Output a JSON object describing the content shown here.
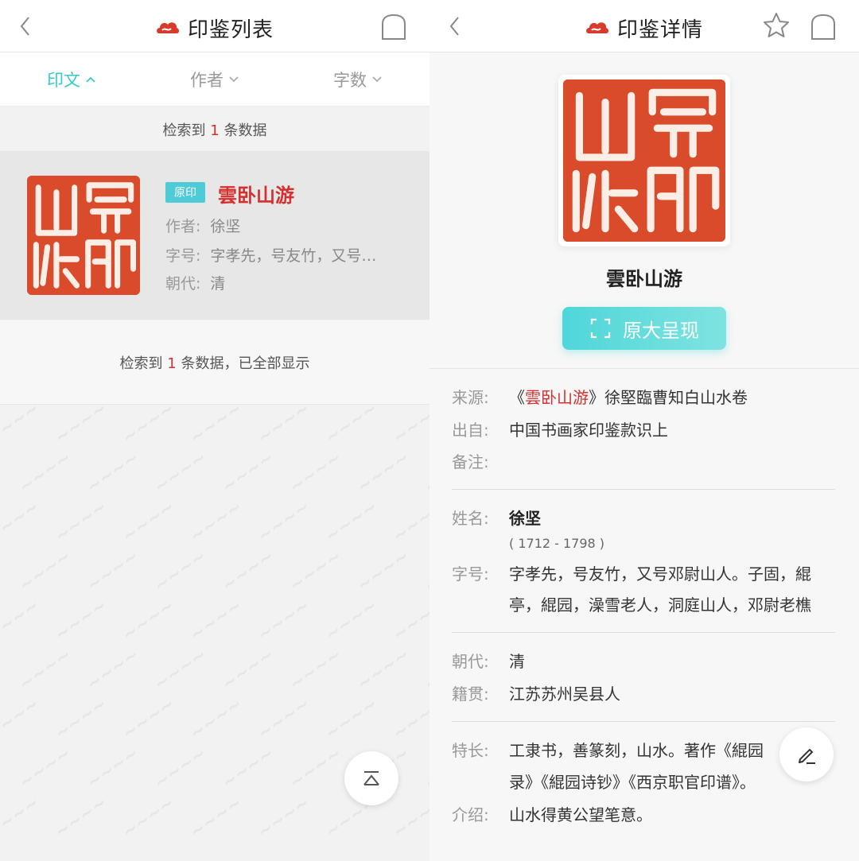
{
  "list_screen": {
    "title": "印鉴列表",
    "tabs": [
      {
        "label": "印文"
      },
      {
        "label": "作者"
      },
      {
        "label": "字数"
      }
    ],
    "count_prefix": "检索到",
    "count_num": "1",
    "count_suffix": "条数据",
    "result": {
      "badge": "原印",
      "title": "雲卧山游",
      "author_label": "作者:",
      "author": "徐坚",
      "zihao_label": "字号:",
      "zihao": "字孝先，号友竹，又号…",
      "dynasty_label": "朝代:",
      "dynasty": "清"
    },
    "footer_prefix": "检索到",
    "footer_num": "1",
    "footer_suffix": "条数据，已全部显示"
  },
  "detail_screen": {
    "title": "印鉴详情",
    "seal_name": "雲卧山游",
    "orig_button": "原大呈现",
    "source_label": "来源:",
    "source_open": "《",
    "source_red": "雲卧山游",
    "source_rest": "》徐堅臨曹知白山水卷",
    "from_label": "出自:",
    "from": "中国书画家印鉴款识上",
    "note_label": "备注:",
    "name_label": "姓名:",
    "name": "徐坚",
    "years": "( 1712 - 1798 )",
    "zihao_label": "字号:",
    "zihao_line1": "字孝先，号友竹，又号邓尉山人。子固，緄",
    "zihao_line2": "亭，緄园，澡雪老人，洞庭山人，邓尉老樵",
    "dynasty_label": "朝代:",
    "dynasty": "清",
    "native_label": "籍贯:",
    "native": "江苏苏州吴县人",
    "skill_label": "特长:",
    "skill_line1": "工隶书，善篆刻，山水。著作《緄园",
    "skill_line2": "录》《緄园诗钞》《西京职官印谱》。",
    "intro_label": "介绍:",
    "intro": "山水得黄公望笔意。"
  },
  "colors": {
    "accent": "#35c9c9",
    "red": "#d43030",
    "seal": "#d94b2a"
  }
}
